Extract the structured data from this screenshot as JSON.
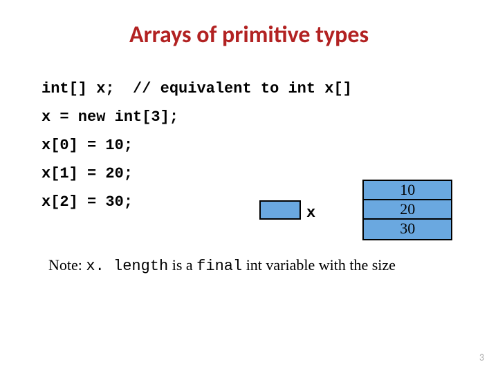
{
  "title": "Arrays of primitive types",
  "code": {
    "line1_decl": "int[] x;",
    "line1_comment": "// equivalent to int x[]",
    "line2": "x = new int[3];",
    "line3": "x[0] = 10;",
    "line4": "x[1] = 20;",
    "line5": "x[2] = 30;"
  },
  "diagram": {
    "ref_label": "x",
    "cells": [
      "10",
      "20",
      "30"
    ]
  },
  "note": {
    "prefix": "Note: ",
    "code1": "x. length",
    "mid": " is a ",
    "code2": "final",
    "suffix": " int variable with the size"
  },
  "page_number": "3"
}
